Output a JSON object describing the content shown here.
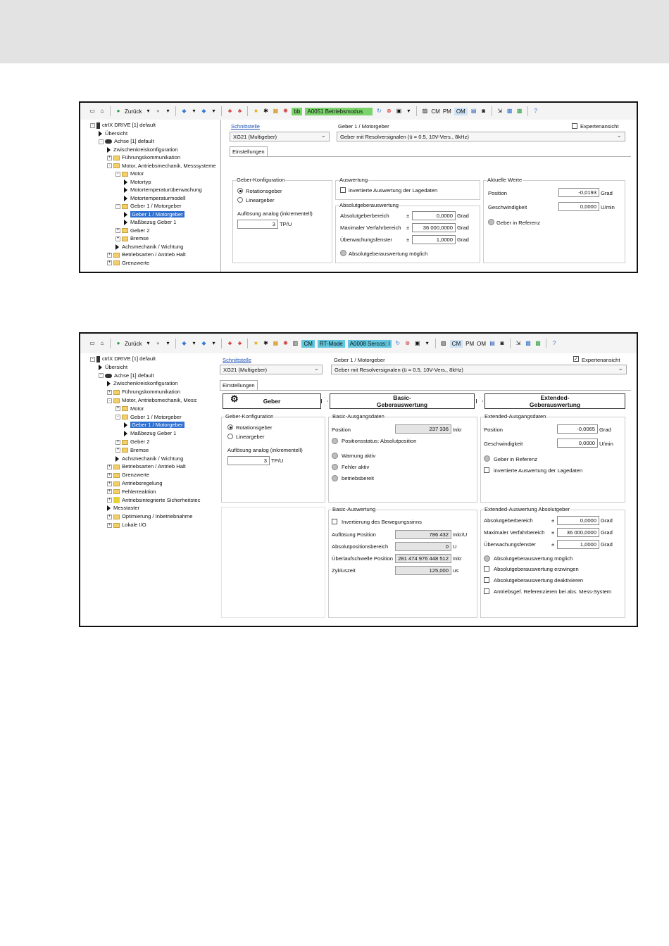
{
  "colors": {
    "statusbar": "#7bd36b",
    "rtmode": "#62c6de",
    "selection": "#2e6fcf",
    "link": "#1d4fb3"
  },
  "s1": {
    "toolbar": {
      "back": "Zurück",
      "status_code": "bb",
      "status_text": "A0051 Betriebsmodus",
      "cm": "CM",
      "pm": "PM",
      "om": "OM"
    },
    "tree": [
      {
        "label": "ctrlX DRIVE [1] default",
        "kind": "device",
        "indent": 0,
        "pm": "-"
      },
      {
        "label": "Übersicht",
        "kind": "leaf",
        "indent": 1
      },
      {
        "label": "Achse [1] default",
        "kind": "axis",
        "indent": 1,
        "pm": "-"
      },
      {
        "label": "Zwischenkreiskonfiguration",
        "kind": "leaf",
        "indent": 2
      },
      {
        "label": "Führungskommunikation",
        "kind": "folder",
        "indent": 2,
        "pm": "+"
      },
      {
        "label": "Motor, Antriebsmechanik, Messsysteme",
        "kind": "folder",
        "indent": 2,
        "pm": "-"
      },
      {
        "label": "Motor",
        "kind": "folder",
        "indent": 3,
        "pm": "-"
      },
      {
        "label": "Motortyp",
        "kind": "leaf",
        "indent": 4
      },
      {
        "label": "Motortemperaturüberwachung",
        "kind": "leaf",
        "indent": 4
      },
      {
        "label": "Motortemperaturmodell",
        "kind": "leaf",
        "indent": 4
      },
      {
        "label": "Geber 1 / Motorgeber",
        "kind": "folder",
        "indent": 3,
        "pm": "-"
      },
      {
        "label": "Geber 1 / Motorgeber",
        "kind": "leaf",
        "indent": 4,
        "selected": true
      },
      {
        "label": "Maßbezug Geber 1",
        "kind": "leaf",
        "indent": 4
      },
      {
        "label": "Geber 2",
        "kind": "folder",
        "indent": 3,
        "pm": "+"
      },
      {
        "label": "Bremse",
        "kind": "folder",
        "indent": 3,
        "pm": "+"
      },
      {
        "label": "Achsmechanik / Wichtung",
        "kind": "leaf",
        "indent": 3
      },
      {
        "label": "Betriebsarten / Antrieb Halt",
        "kind": "folder",
        "indent": 2,
        "pm": "+"
      },
      {
        "label": "Grenzwerte",
        "kind": "folder",
        "indent": 2,
        "pm": "+"
      }
    ],
    "schnittstelle": "Schnittstelle",
    "interface_value": "XG21 (Multigeber)",
    "geber_title": "Geber 1 / Motorgeber",
    "geber_value": "Geber mit Resolversignalen (ü = 0.5, 10V-Vers., 8kHz)",
    "expert": "Expertenansicht",
    "tab": "Einstellungen",
    "gk": {
      "legend": "Geber-Konfiguration",
      "r1": "Rotationsgeber",
      "r2": "Lineargeber",
      "res_label": "Auflösung analog (inkrementell)",
      "res_value": "3",
      "res_unit": "TP/U"
    },
    "ausw": {
      "legend": "Auswertung",
      "cb": "invertierte Auswertung der Lagedaten"
    },
    "abs": {
      "legend": "Absolutgeberauswertung",
      "rows": [
        {
          "label": "Absolutgeberbereich",
          "pm": "±",
          "value": "0,0000",
          "unit": "Grad"
        },
        {
          "label": "Maximaler Verfahrbereich",
          "pm": "±",
          "value": "36 000,0000",
          "unit": "Grad"
        },
        {
          "label": "Überwachungsfenster",
          "pm": "±",
          "value": "1,0000",
          "unit": "Grad"
        }
      ],
      "led": "Absolutgeberauswertung möglich"
    },
    "akt": {
      "legend": "Aktuelle Werte",
      "pos_label": "Position",
      "pos_value": "-0,0193",
      "pos_unit": "Grad",
      "v_label": "Geschwindigkeit",
      "v_value": "0,0000",
      "v_unit": "U/min",
      "led": "Geber in Referenz"
    }
  },
  "s2": {
    "toolbar": {
      "back": "Zurück",
      "cm1": "CM",
      "rtmode": "RT-Mode",
      "status_text": "A0008 Sercos: I",
      "cm": "CM",
      "pm": "PM",
      "om": "OM"
    },
    "tree": [
      {
        "label": "ctrlX DRIVE [1] default",
        "kind": "device",
        "indent": 0,
        "pm": "-"
      },
      {
        "label": "Übersicht",
        "kind": "leaf",
        "indent": 1
      },
      {
        "label": "Achse [1] default",
        "kind": "axis",
        "indent": 1,
        "pm": "-"
      },
      {
        "label": "Zwischenkreiskonfiguration",
        "kind": "leaf",
        "indent": 2
      },
      {
        "label": "Führungskommunikation",
        "kind": "folder",
        "indent": 2,
        "pm": "+"
      },
      {
        "label": "Motor, Antriebsmechanik, Mess:",
        "kind": "folder",
        "indent": 2,
        "pm": "-"
      },
      {
        "label": "Motor",
        "kind": "folder",
        "indent": 3,
        "pm": "+"
      },
      {
        "label": "Geber 1 / Motorgeber",
        "kind": "folder",
        "indent": 3,
        "pm": "-"
      },
      {
        "label": "Geber 1 / Motorgeber",
        "kind": "leaf",
        "indent": 4,
        "selected": true
      },
      {
        "label": "Maßbezug Geber 1",
        "kind": "leaf",
        "indent": 4
      },
      {
        "label": "Geber 2",
        "kind": "folder",
        "indent": 3,
        "pm": "+"
      },
      {
        "label": "Bremse",
        "kind": "folder",
        "indent": 3,
        "pm": "+"
      },
      {
        "label": "Achsmechanik / Wichtung",
        "kind": "leaf",
        "indent": 3
      },
      {
        "label": "Betriebsarten / Antrieb Halt",
        "kind": "folder",
        "indent": 2,
        "pm": "+"
      },
      {
        "label": "Grenzwerte",
        "kind": "folder",
        "indent": 2,
        "pm": "+"
      },
      {
        "label": "Antriebsregelung",
        "kind": "folder",
        "indent": 2,
        "pm": "+"
      },
      {
        "label": "Fehlerreaktion",
        "kind": "folder",
        "indent": 2,
        "pm": "+"
      },
      {
        "label": "Antriebsintegrierte Sicherheitstec",
        "kind": "safety",
        "indent": 2,
        "pm": "+"
      },
      {
        "label": "Messtaster",
        "kind": "leaf",
        "indent": 2
      },
      {
        "label": "Optimierung / Inbetriebnahme",
        "kind": "folder",
        "indent": 2,
        "pm": "+"
      },
      {
        "label": "Lokale I/O",
        "kind": "folder",
        "indent": 2,
        "pm": "+"
      }
    ],
    "schnittstelle": "Schnittstelle",
    "interface_value": "XG21 (Multigeber)",
    "geber_title": "Geber 1 / Motorgeber",
    "geber_value": "Geber mit Resolversignalen (ü = 0.5, 10V-Vers., 8kHz)",
    "expert": "Expertenansicht",
    "expert_checked": true,
    "tab": "Einstellungen",
    "headers": {
      "geber": "Geber",
      "basic1": "Basic-",
      "basic2": "Geberauswertung",
      "ext1": "Extended-",
      "ext2": "Geberauswertung"
    },
    "gk": {
      "legend": "Geber-Konfiguration",
      "r1": "Rotationsgeber",
      "r2": "Lineargeber",
      "res_label": "Auflösung analog (inkrementell)",
      "res_value": "3",
      "res_unit": "TP/U"
    },
    "bad": {
      "legend": "Basic-Ausgangsdaten",
      "pos_label": "Position",
      "pos_value": "237 336",
      "pos_unit": "Inkr",
      "status": "Positionsstatus: Absolutposition",
      "w": "Warnung aktiv",
      "f": "Fehler aktiv",
      "b": "betriebsbereit"
    },
    "ead": {
      "legend": "Extended-Ausgangsdaten",
      "pos_label": "Position",
      "pos_value": "-0,0065",
      "pos_unit": "Grad",
      "v_label": "Geschwindigkeit",
      "v_value": "0,0000",
      "v_unit": "U/min",
      "led": "Geber in Referenz",
      "cb": "invertierte Auswertung der Lagedaten"
    },
    "ba": {
      "legend": "Basic-Auswertung",
      "cb": "Invertierung des Bewegungssinns",
      "rows": [
        {
          "label": "Auflösung Position",
          "value": "786 432",
          "unit": "Inkr/U"
        },
        {
          "label": "Absolutpositionsbereich",
          "value": "0",
          "unit": "U"
        },
        {
          "label": "Überlaufschwelle Position",
          "value": "281 474 976 448 512",
          "unit": "Inkr"
        },
        {
          "label": "Zykluszeit",
          "value": "125,000",
          "unit": "us"
        }
      ]
    },
    "eaa": {
      "legend": "Extended-Auswertung Absolutgeber",
      "rows": [
        {
          "label": "Absolutgeberbereich",
          "pm": "±",
          "value": "0,0000",
          "unit": "Grad"
        },
        {
          "label": "Maximaler Verfahrbereich",
          "pm": "±",
          "value": "36 000,0000",
          "unit": "Grad"
        },
        {
          "label": "Überwachungsfenster",
          "pm": "±",
          "value": "1,0000",
          "unit": "Grad"
        }
      ],
      "led": "Absolutgeberauswertung möglich",
      "cb1": "Absolutgeberauswertung erzwingen",
      "cb2": "Absolutgeberauswertung deaktivieren",
      "cb3": "Antriebsgef. Referenzieren bei abs. Mess-System"
    }
  }
}
